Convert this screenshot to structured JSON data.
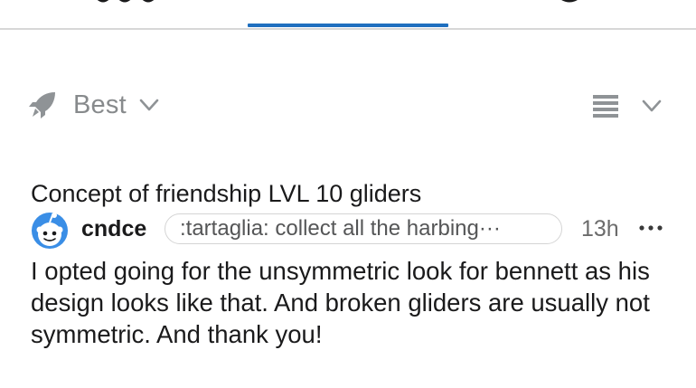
{
  "sort": {
    "label": "Best"
  },
  "comment": {
    "post_title": "Concept of friendship LVL 10 gliders",
    "username": "cndce",
    "flair": ":tartaglia: collect all the harbing···",
    "timestamp": "13h",
    "body": "I opted going for the unsymmetric look for bennett as his design looks like that. And broken gliders are usually not symmetric. And thank you!"
  },
  "icons": {
    "sort": "rocket-icon",
    "sort_dropdown": "chevron-down-icon",
    "view_mode": "list-view-icon",
    "view_dropdown": "chevron-down-icon",
    "avatar": "snoo-avatar-icon",
    "more": "more-options-icon"
  },
  "colors": {
    "active_tab_indicator": "#1f6fbf",
    "muted_text": "#878a8c",
    "body_text": "#1a1a1b",
    "avatar_blue": "#3a8ee6"
  }
}
